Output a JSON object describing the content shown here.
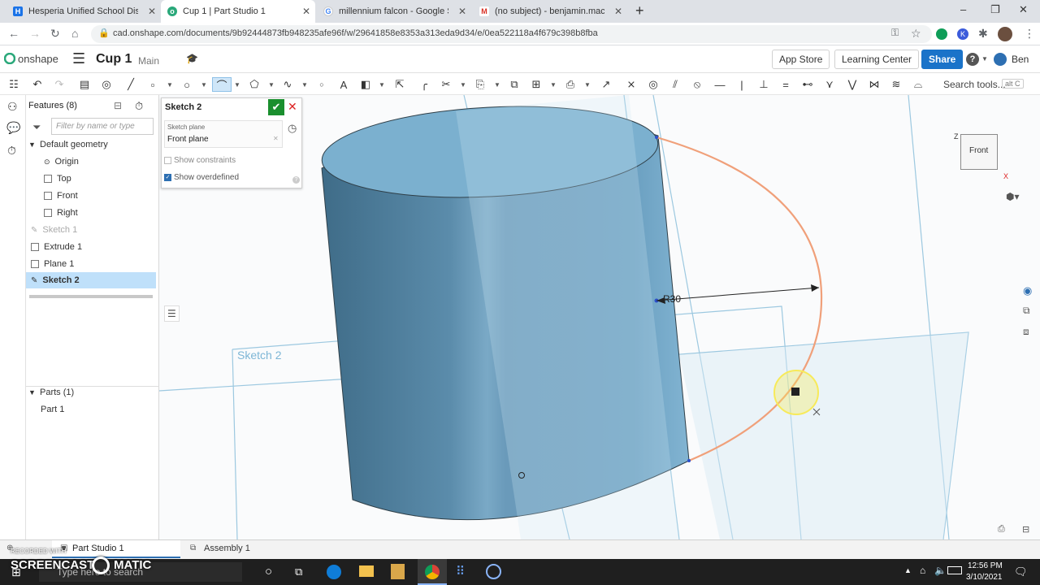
{
  "browser": {
    "tabs": [
      {
        "title": "Hesperia Unified School District",
        "fav_color": "#1a73e8",
        "fav": "H"
      },
      {
        "title": "Cup 1 | Part Studio 1",
        "fav_color": "#2aa87a",
        "fav": "o"
      },
      {
        "title": "millennium falcon - Google Search",
        "fav_color": "#4285f4",
        "fav": "G"
      },
      {
        "title": "(no subject) - benjamin.macmahon",
        "fav_color": "#d93025",
        "fav": "M"
      }
    ],
    "new_tab": "+",
    "url": "cad.onshape.com/documents/9b92444873fb948235afe96f/w/29641858e8353a313eda9d34/e/0ea522118a4f679c398b8fba",
    "window_controls": [
      "–",
      "❐",
      "✕"
    ]
  },
  "onshape": {
    "logo_text": "onshape",
    "doc_title": "Cup 1",
    "branch": "Main",
    "app_store": "App Store",
    "learning_center": "Learning Center",
    "share": "Share",
    "help": "?",
    "user": "Ben",
    "search_tools": "Search tools...",
    "search_shortcut": "alt C"
  },
  "features": {
    "header": "Features (8)",
    "filter_placeholder": "Filter by name or type",
    "default_geometry": "Default geometry",
    "origin": "Origin",
    "top": "Top",
    "front": "Front",
    "right": "Right",
    "sketch1": "Sketch 1",
    "extrude1": "Extrude 1",
    "plane1": "Plane 1",
    "sketch2": "Sketch 2",
    "parts_header": "Parts (1)",
    "part1": "Part 1"
  },
  "sketch_dialog": {
    "title": "Sketch 2",
    "plane_label": "Sketch plane",
    "plane_value": "Front plane",
    "show_constraints": "Show constraints",
    "show_constraints_checked": false,
    "show_overdefined": "Show overdefined",
    "show_overdefined_checked": true
  },
  "viewport": {
    "sketch_label": "Sketch 2",
    "dimension": "R30",
    "view_cube_face": "Front",
    "axis_x": "X",
    "axis_z": "Z",
    "colors": {
      "part": "#5f8fae",
      "sketch_arc": "#f0a07a",
      "plane": "#9cc8e0",
      "highlight": "#f7ea5a"
    }
  },
  "bottom_tabs": {
    "part_studio": "Part Studio 1",
    "assembly": "Assembly 1"
  },
  "taskbar": {
    "search_placeholder": "Type here to search",
    "time": "12:56 PM",
    "date": "3/10/2021",
    "watermark_top": "RECORDED WITH",
    "watermark_main": "SCREENCAST",
    "watermark_tail": "MATIC"
  }
}
